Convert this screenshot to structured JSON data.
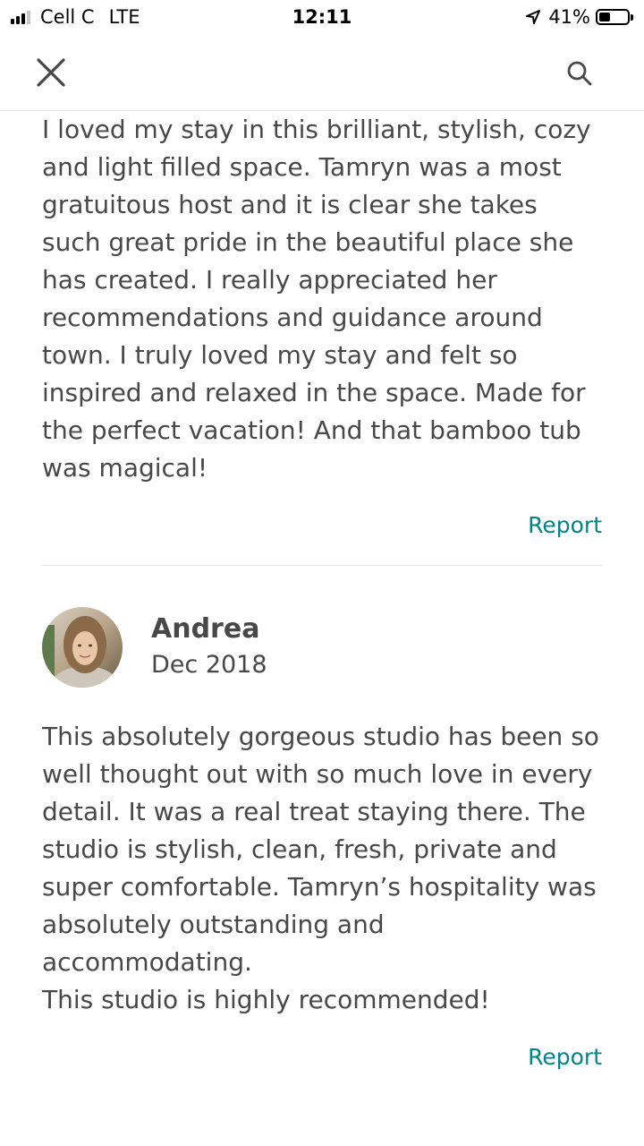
{
  "status_bar": {
    "carrier": "Cell C",
    "network": "LTE",
    "time": "12:11",
    "battery": "41%",
    "battery_level": 0.41
  },
  "nav": {
    "close_icon": "close-icon",
    "search_icon": "search-icon"
  },
  "reviews": [
    {
      "text": "lovely Birdhouse experience, the Birdhouse. I loved my stay in this brilliant, stylish, cozy and light filled space. Tamryn was a most gratuitous host and it is clear she takes such great pride in the beautiful place she has created. I really appreciated her recommendations and guidance around town. I truly loved my stay and felt so inspired and relaxed in the space. Made for the perfect vacation! And that bamboo tub was magical!",
      "report_label": "Report"
    },
    {
      "name": "Andrea",
      "date": "Dec 2018",
      "text": "This absolutely gorgeous studio has been so well thought out with so much love in every detail.  It was a real treat staying there. The studio is stylish, clean, fresh, private and super comfortable. Tamryn’s hospitality was absolutely outstanding and accommodating.\nThis studio is highly recommended!",
      "report_label": "Report"
    }
  ],
  "colors": {
    "text": "#484848",
    "accent": "#008489",
    "divider": "#e4e4e4"
  }
}
